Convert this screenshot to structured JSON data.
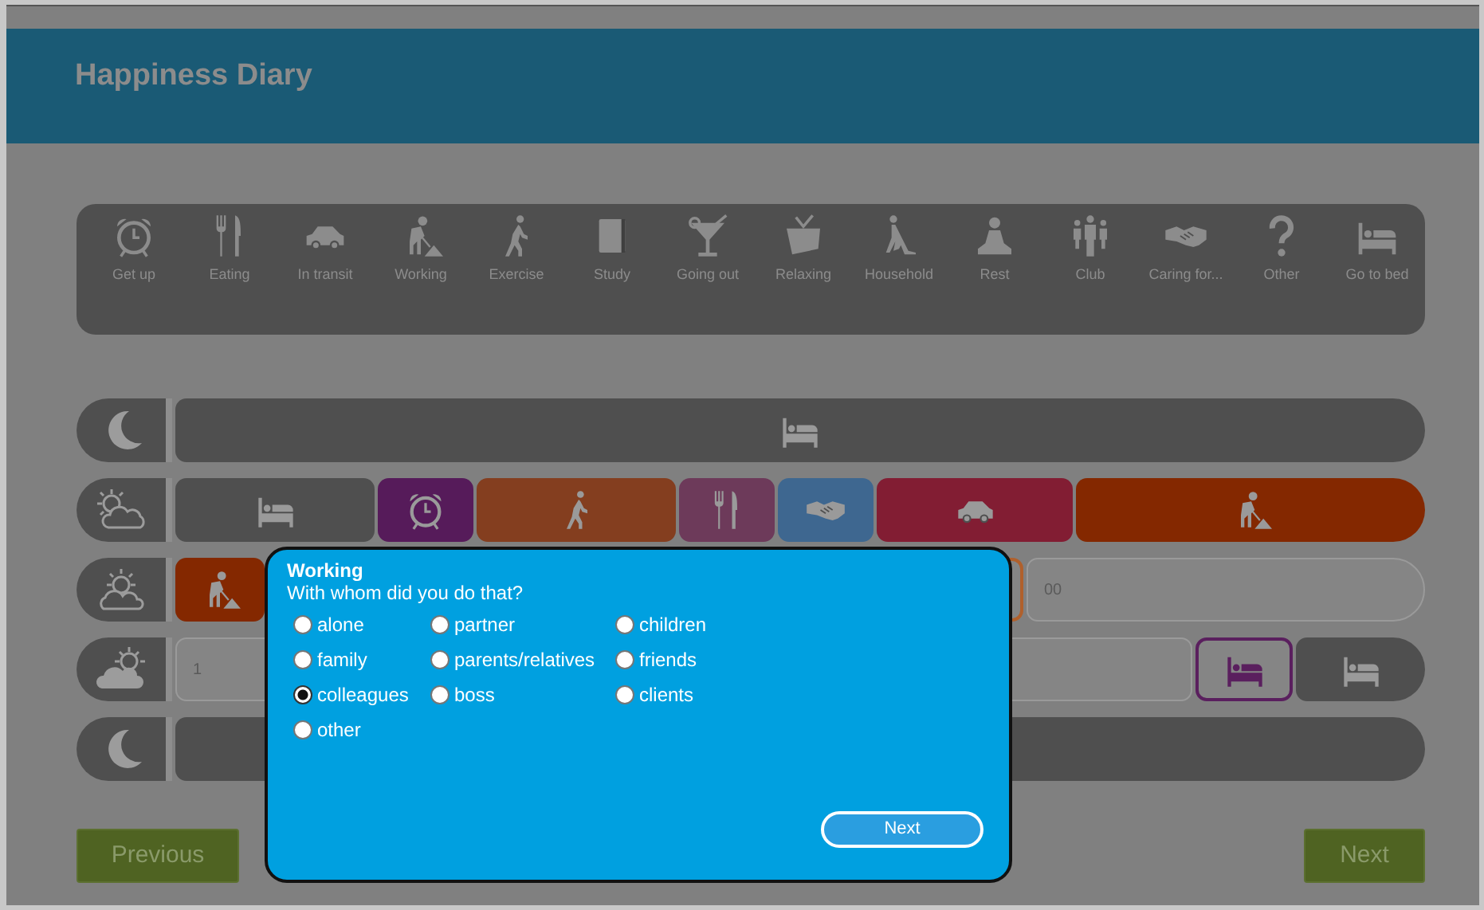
{
  "header": {
    "title": "Happiness Diary"
  },
  "activities": [
    {
      "label": "Get up",
      "kind": "clock"
    },
    {
      "label": "Eating",
      "kind": "cutlery"
    },
    {
      "label": "In transit",
      "kind": "car"
    },
    {
      "label": "Working",
      "kind": "worker"
    },
    {
      "label": "Exercise",
      "kind": "walker"
    },
    {
      "label": "Study",
      "kind": "book"
    },
    {
      "label": "Going out",
      "kind": "cocktail"
    },
    {
      "label": "Relaxing",
      "kind": "tv"
    },
    {
      "label": "Household",
      "kind": "vacuum"
    },
    {
      "label": "Rest",
      "kind": "meditate"
    },
    {
      "label": "Club",
      "kind": "people"
    },
    {
      "label": "Caring for...",
      "kind": "handshake"
    },
    {
      "label": "Other",
      "kind": "question"
    },
    {
      "label": "Go to bed",
      "kind": "bed"
    }
  ],
  "timeline": [
    {
      "kind": "night",
      "segments": [
        {
          "kind": "bed",
          "color": "#4f4f4f",
          "outlined": false
        }
      ]
    },
    {
      "kind": "morning",
      "segments": [
        {
          "kind": "bed",
          "color": "#4f4f4f",
          "outlined": false
        },
        {
          "kind": "clock",
          "color": "#561b5a",
          "outlined": false
        },
        {
          "kind": "walker",
          "color": "#843e1f",
          "outlined": false
        },
        {
          "kind": "cutlery",
          "color": "#6d3a5a",
          "outlined": false
        },
        {
          "kind": "handshake",
          "color": "#3e6790",
          "outlined": false
        },
        {
          "kind": "car",
          "color": "#821d33",
          "outlined": false
        },
        {
          "kind": "worker",
          "color": "#842800",
          "outlined": false
        }
      ]
    },
    {
      "kind": "afternoon",
      "segments": [
        {
          "kind": "worker",
          "color": "#842800",
          "outlined": false
        },
        {
          "kind": "empty",
          "color": "#b0602c",
          "outlined": true
        },
        {
          "kind": "field",
          "text": "00"
        }
      ]
    },
    {
      "kind": "evening",
      "segments": [
        {
          "kind": "field",
          "text": "1"
        },
        {
          "kind": "bed",
          "color": "#5a1f5e",
          "outlined": true
        },
        {
          "kind": "bed",
          "color": "#4f4f4f",
          "outlined": false
        }
      ]
    },
    {
      "kind": "night",
      "segments": [
        {
          "kind": "empty",
          "color": "#4f4f4f",
          "outlined": false
        }
      ]
    }
  ],
  "dialog": {
    "title": "Working",
    "question": "With whom did you do that?",
    "options": [
      {
        "label": "alone",
        "selected": false
      },
      {
        "label": "partner",
        "selected": false
      },
      {
        "label": "children",
        "selected": false
      },
      {
        "label": "family",
        "selected": false
      },
      {
        "label": "parents/relatives",
        "selected": false
      },
      {
        "label": "friends",
        "selected": false
      },
      {
        "label": "colleagues",
        "selected": true
      },
      {
        "label": "boss",
        "selected": false
      },
      {
        "label": "clients",
        "selected": false
      },
      {
        "label": "other",
        "selected": false
      }
    ],
    "button": "Next"
  },
  "navigation": {
    "previous": "Previous",
    "next": "Next"
  }
}
